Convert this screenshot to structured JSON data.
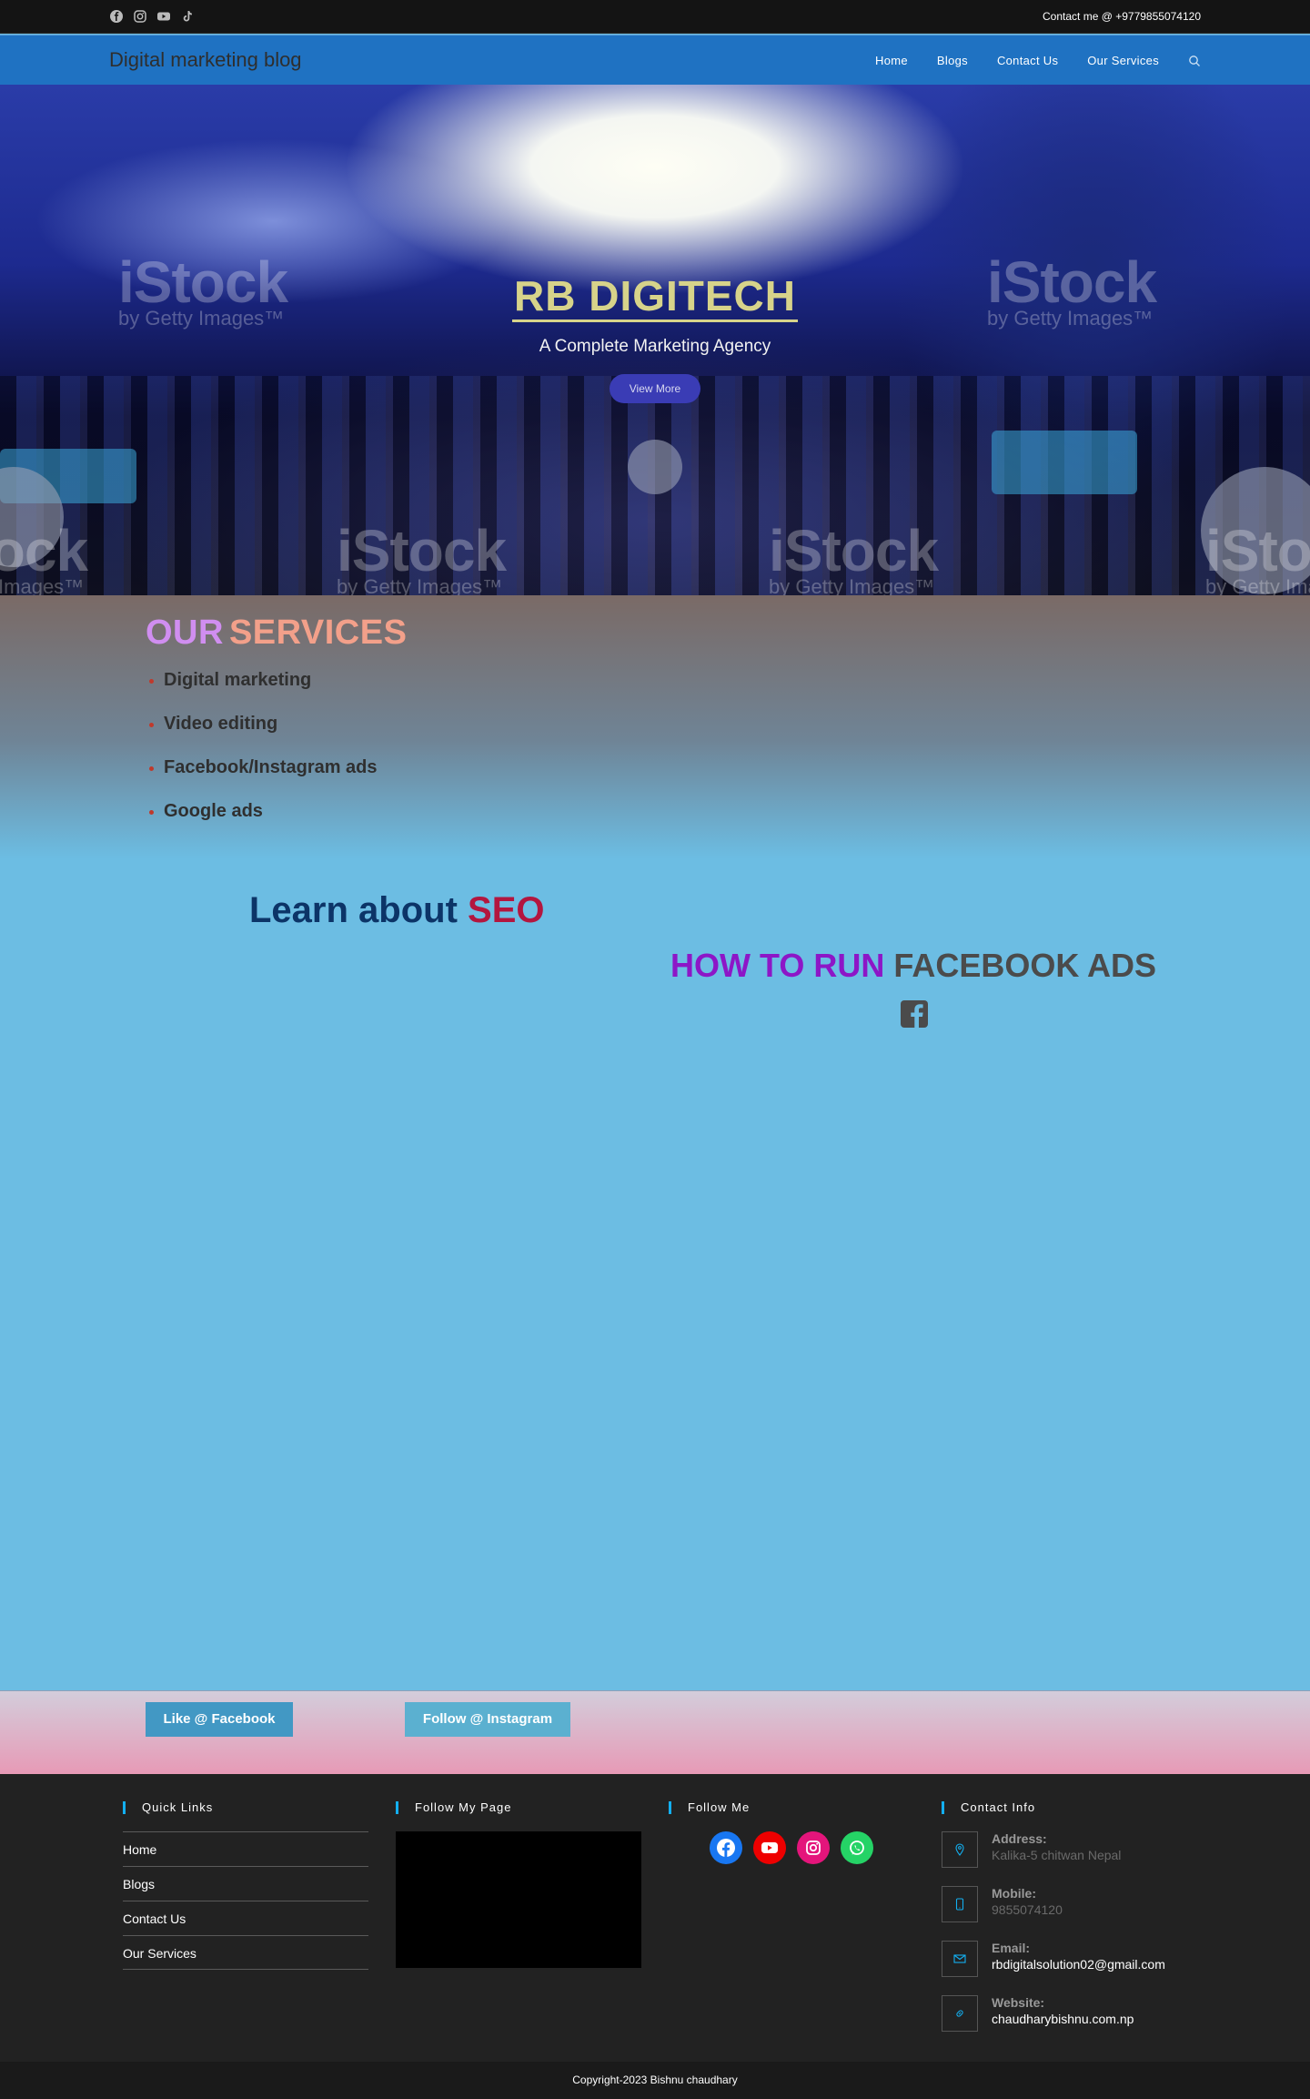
{
  "topbar": {
    "social_icons": [
      "facebook-icon",
      "instagram-icon",
      "youtube-icon",
      "tiktok-icon"
    ],
    "contact_text": "Contact me @ +9779855074120"
  },
  "header": {
    "brand": "Digital marketing blog",
    "nav": [
      "Home",
      "Blogs",
      "Contact Us",
      "Our Services"
    ],
    "search_icon": "search-icon"
  },
  "hero": {
    "title": "RB DIGITECH",
    "subtitle": "A Complete Marketing Agency",
    "button": "View More",
    "watermark": "iStock",
    "watermark_sub": "by Getty Images™"
  },
  "services": {
    "heading_1": "OUR",
    "heading_2": "SERVICES",
    "items": [
      "Digital marketing",
      "Video editing",
      "Facebook/Instagram ads",
      "Google ads"
    ]
  },
  "learn": {
    "text": "Learn about",
    "highlight": "SEO"
  },
  "facebook_ads": {
    "highlight": "HOW TO RUN",
    "text": "FACEBOOK ADS",
    "icon": "facebook-square-icon"
  },
  "widgets": {
    "facebook_button": "Like @ Facebook",
    "instagram_button": "Follow @ Instagram"
  },
  "footer": {
    "quick_links_title": "Quick Links",
    "quick_links": [
      "Home",
      "Blogs",
      "Contact Us",
      "Our Services"
    ],
    "follow_page_title": "Follow My Page",
    "follow_me_title": "Follow Me",
    "follow_icons": [
      "facebook-icon",
      "youtube-icon",
      "instagram-icon",
      "whatsapp-icon"
    ],
    "contact_title": "Contact Info",
    "contact": {
      "address_label": "Address:",
      "address": "Kalika-5 chitwan Nepal",
      "mobile_label": "Mobile:",
      "mobile": "9855074120",
      "email_label": "Email:",
      "email": "rbdigitalsolution02@gmail.com",
      "website_label": "Website:",
      "website": "chaudharybishnu.com.np"
    },
    "copyright": "Copyright-2023 Bishnu chaudhary"
  },
  "colors": {
    "header_bg": "#1f72c2",
    "accent": "#13aff0",
    "page_bg": "#6cbde3"
  }
}
